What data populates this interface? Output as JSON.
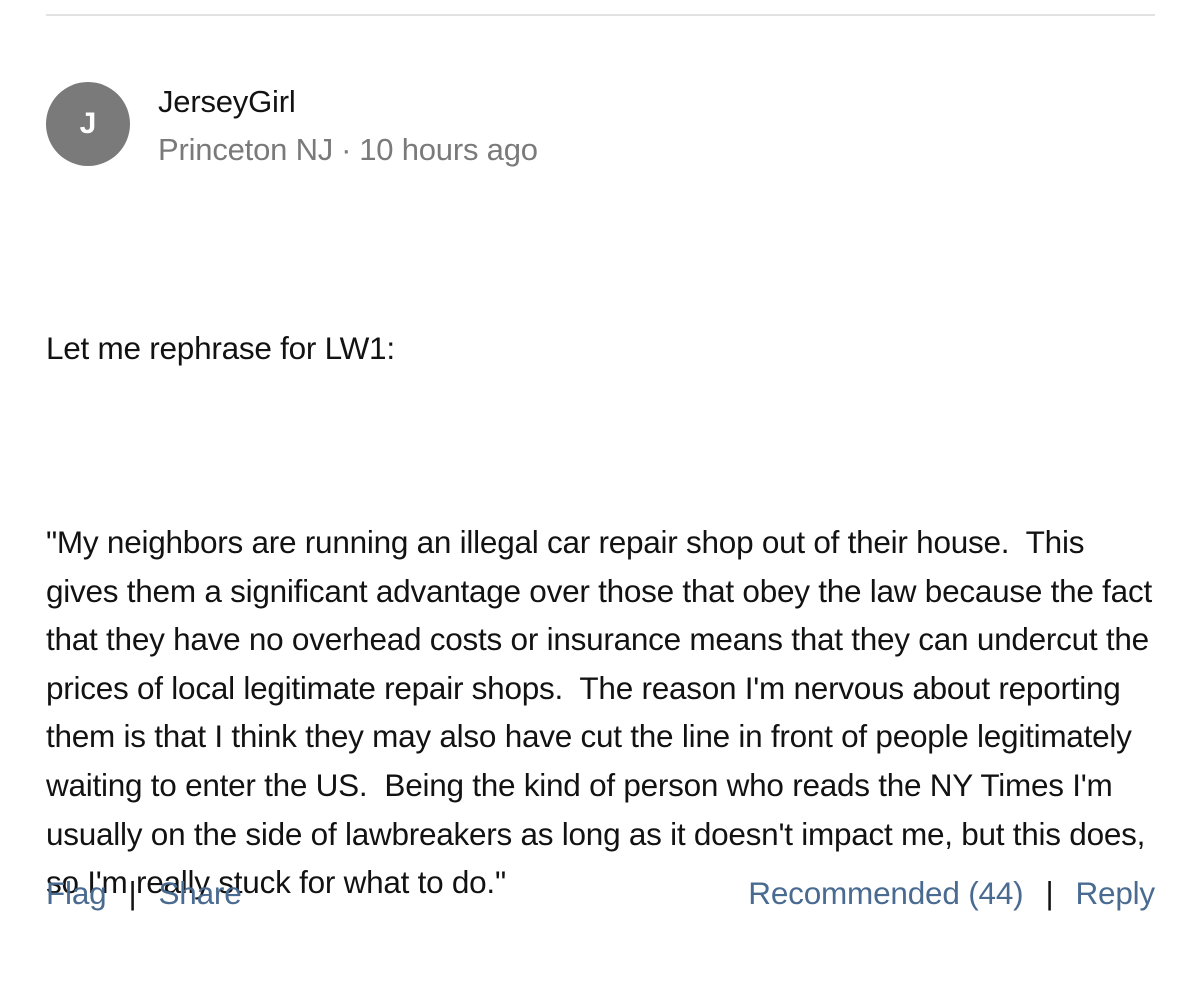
{
  "comment": {
    "avatar_initial": "J",
    "author": "JerseyGirl",
    "location": "Princeton NJ",
    "meta_separator": "·",
    "time_ago": "10 hours ago",
    "body": {
      "paragraph_1": "Let me rephrase for LW1:",
      "paragraph_2": "\"My neighbors are running an illegal car repair shop out of their house.  This gives them a significant advantage over those that obey the law because the fact that they have no overhead costs or insurance means that they can undercut the prices of local legitimate repair shops.  The reason I'm nervous about reporting them is that I think they may also have cut the line in front of people legitimately waiting to enter the US.  Being the kind of person who reads the NY Times I'm usually on the side of lawbreakers as long as it doesn't impact me, but this does, so I'm really stuck for what to do.\""
    }
  },
  "footer": {
    "flag_label": "Flag",
    "share_label": "Share",
    "recommended_label": "Recommended (44)",
    "reply_label": "Reply",
    "separator": "|"
  },
  "colors": {
    "link": "#4a6b91",
    "meta_gray": "#7a7a7a",
    "avatar_bg": "#7a7a7a",
    "divider": "#e2e2e2"
  }
}
